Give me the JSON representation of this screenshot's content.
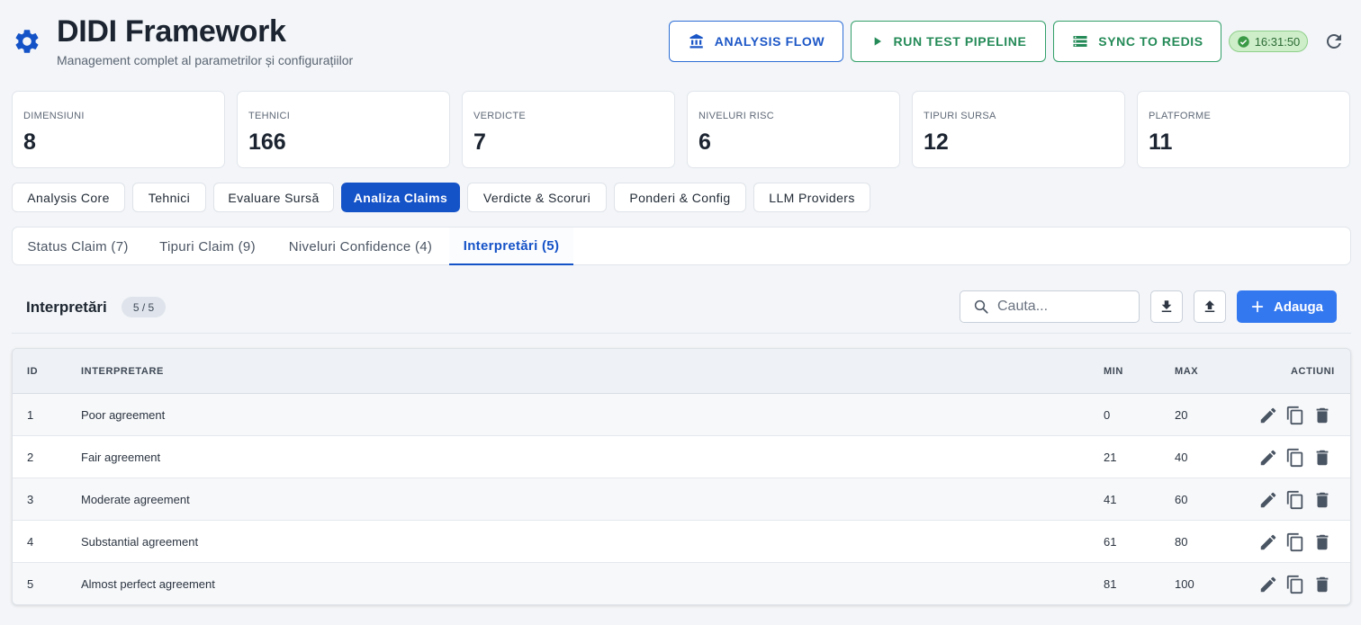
{
  "app": {
    "title": "DIDI Framework",
    "subtitle": "Management complet al parametrilor și configurațiilor"
  },
  "header_actions": {
    "analysis_flow": "ANALYSIS FLOW",
    "run_pipeline": "RUN TEST PIPELINE",
    "sync_redis": "SYNC TO REDIS",
    "clock": "16:31:50"
  },
  "stats": [
    {
      "label": "DIMENSIUNI",
      "value": "8"
    },
    {
      "label": "TEHNICI",
      "value": "166"
    },
    {
      "label": "VERDICTE",
      "value": "7"
    },
    {
      "label": "NIVELURI RISC",
      "value": "6"
    },
    {
      "label": "TIPURI SURSA",
      "value": "12"
    },
    {
      "label": "PLATFORME",
      "value": "11"
    }
  ],
  "main_tabs": [
    {
      "label": "Analysis Core",
      "active": false
    },
    {
      "label": "Tehnici",
      "active": false
    },
    {
      "label": "Evaluare Sursă",
      "active": false
    },
    {
      "label": "Analiza Claims",
      "active": true
    },
    {
      "label": "Verdicte & Scoruri",
      "active": false
    },
    {
      "label": "Ponderi & Config",
      "active": false
    },
    {
      "label": "LLM Providers",
      "active": false
    }
  ],
  "sub_tabs": [
    {
      "label": "Status Claim (7)",
      "active": false
    },
    {
      "label": "Tipuri Claim (9)",
      "active": false
    },
    {
      "label": "Niveluri Confidence (4)",
      "active": false
    },
    {
      "label": "Interpretări (5)",
      "active": true
    }
  ],
  "table_section": {
    "title": "Interpretări",
    "count": "5 / 5",
    "search_placeholder": "Cauta...",
    "add_label": "Adauga"
  },
  "table": {
    "columns": {
      "id": "ID",
      "interpretare": "INTERPRETARE",
      "min": "MIN",
      "max": "MAX",
      "actions": "ACTIUNI"
    },
    "rows": [
      {
        "id": "1",
        "interpretare": "Poor agreement",
        "min": "0",
        "max": "20"
      },
      {
        "id": "2",
        "interpretare": "Fair agreement",
        "min": "21",
        "max": "40"
      },
      {
        "id": "3",
        "interpretare": "Moderate agreement",
        "min": "41",
        "max": "60"
      },
      {
        "id": "4",
        "interpretare": "Substantial agreement",
        "min": "61",
        "max": "80"
      },
      {
        "id": "5",
        "interpretare": "Almost perfect agreement",
        "min": "81",
        "max": "100"
      }
    ]
  },
  "colors": {
    "primary": "#1452c7",
    "accent_add": "#3478f0",
    "success": "#248a57",
    "clock_bg": "#cdeec9"
  },
  "icons": {
    "brand": "gear-icon",
    "analysis_flow": "bank-icon",
    "run": "play-icon",
    "sync": "database-icon",
    "clock": "check-circle-icon",
    "refresh": "refresh-icon",
    "search": "search-icon",
    "export": "download-icon",
    "import": "upload-icon",
    "add": "plus-icon",
    "edit": "pencil-icon",
    "duplicate": "copy-icon",
    "delete": "trash-icon"
  }
}
